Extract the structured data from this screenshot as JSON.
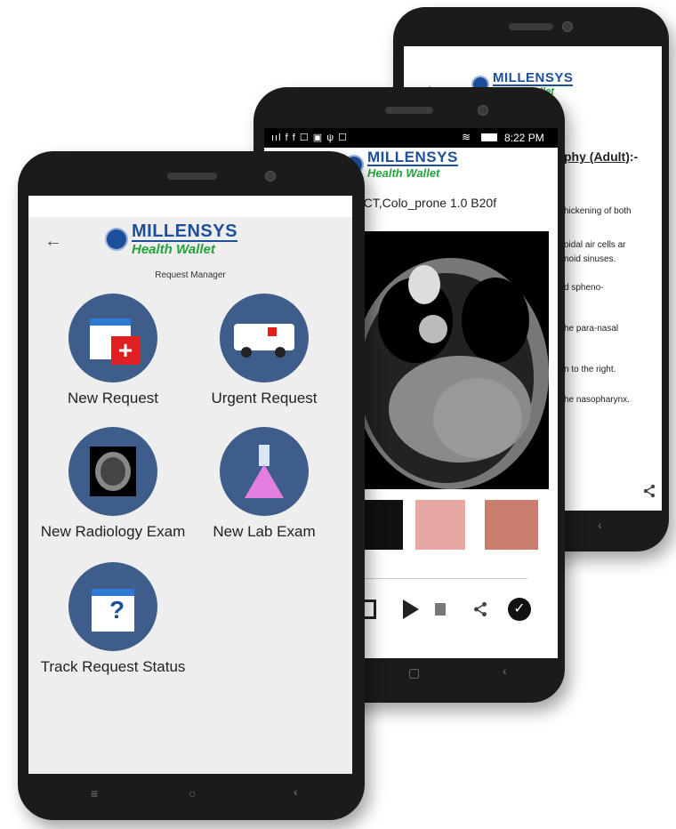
{
  "back_phone": {
    "title_fragment": "phy (Adult)",
    "title_suffix": ":-",
    "text_lines": [
      "hickening of both",
      "oidal air cells ar",
      "noid sinuses.",
      "d spheno-",
      "he para-nasal",
      "n to the right.",
      "he nasopharynx."
    ],
    "back_label": "←"
  },
  "middle_phone": {
    "status_time": "8:22 PM",
    "status_icons": "ııl  f  f  ☐  ▣  ψ  ☐",
    "series_title": "2,CT,Colo_prone  1.0  B20f"
  },
  "front_phone": {
    "logo": {
      "brand": "MILLENSYS",
      "product": "Health Wallet"
    },
    "back_label": "←",
    "page_title": "Request Manager",
    "tiles": {
      "new_request": "New Request",
      "urgent_request": "Urgent Request",
      "new_radiology": "New Radiology Exam",
      "new_lab": "New Lab Exam",
      "track_status": "Track Request Status"
    },
    "nav": {
      "menu": "≡",
      "home": "○",
      "back": "‹"
    }
  }
}
